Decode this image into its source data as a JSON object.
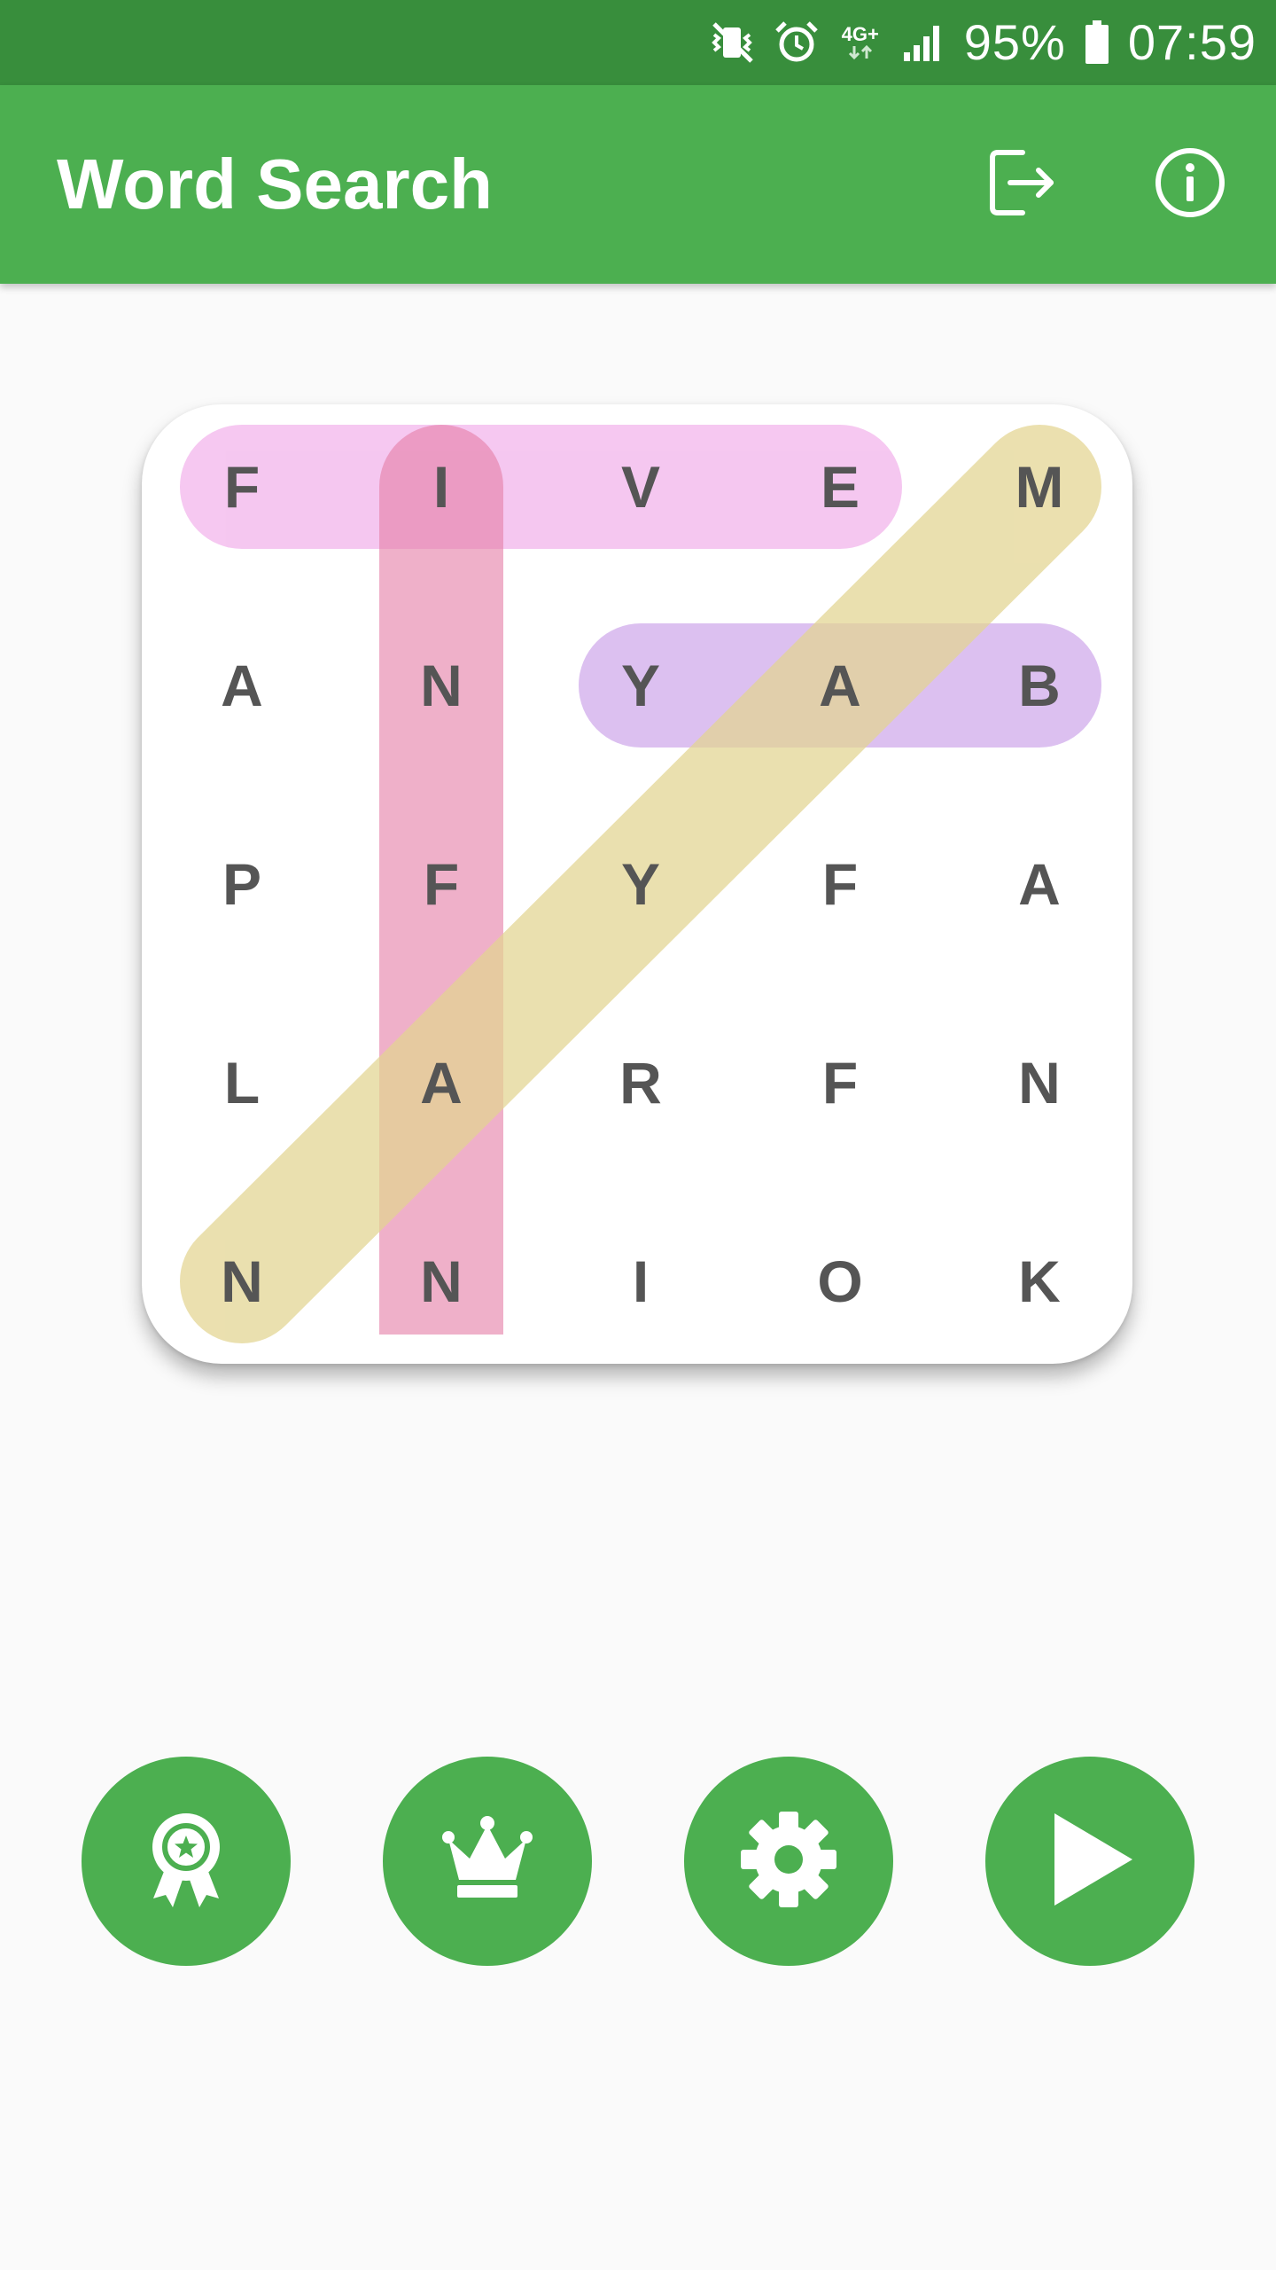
{
  "status_bar": {
    "network": "4G+",
    "battery": "95%",
    "time": "07:59",
    "icons": [
      "vibrate-mute-icon",
      "alarm-icon",
      "network-4g-icon",
      "signal-icon",
      "battery-icon"
    ]
  },
  "app_bar": {
    "title": "Word Search",
    "actions": [
      "exit-icon",
      "info-icon"
    ]
  },
  "board": {
    "rows": 5,
    "cols": 5,
    "grid": [
      [
        "F",
        "I",
        "V",
        "E",
        "M"
      ],
      [
        "A",
        "N",
        "Y",
        "A",
        "B"
      ],
      [
        "P",
        "F",
        "Y",
        "F",
        "A"
      ],
      [
        "L",
        "A",
        "R",
        "F",
        "N"
      ],
      [
        "N",
        "N",
        "I",
        "O",
        "K"
      ]
    ],
    "found_words": [
      {
        "word": "FIVE",
        "from": [
          0,
          0
        ],
        "to": [
          0,
          3
        ],
        "color": "#f0a6e8"
      },
      {
        "word": "INFAN",
        "from": [
          0,
          1
        ],
        "to": [
          4,
          1
        ],
        "color": "#e57fa8"
      },
      {
        "word": "YAB",
        "from": [
          1,
          2
        ],
        "to": [
          1,
          4
        ],
        "color": "#c79ae8"
      },
      {
        "word": "NAYAM",
        "from": [
          4,
          0
        ],
        "to": [
          0,
          4
        ],
        "color": "#e3d591"
      }
    ]
  },
  "bottom_buttons": [
    {
      "name": "achievements-button",
      "icon": "award-ribbon-icon"
    },
    {
      "name": "leaderboard-button",
      "icon": "crown-icon"
    },
    {
      "name": "settings-button",
      "icon": "gear-icon"
    },
    {
      "name": "play-button",
      "icon": "play-icon"
    }
  ],
  "colors": {
    "status_bar": "#388e3c",
    "app_bar": "#4caf50",
    "accent": "#4caf50",
    "background": "#fafafa",
    "letters": "#555555"
  }
}
